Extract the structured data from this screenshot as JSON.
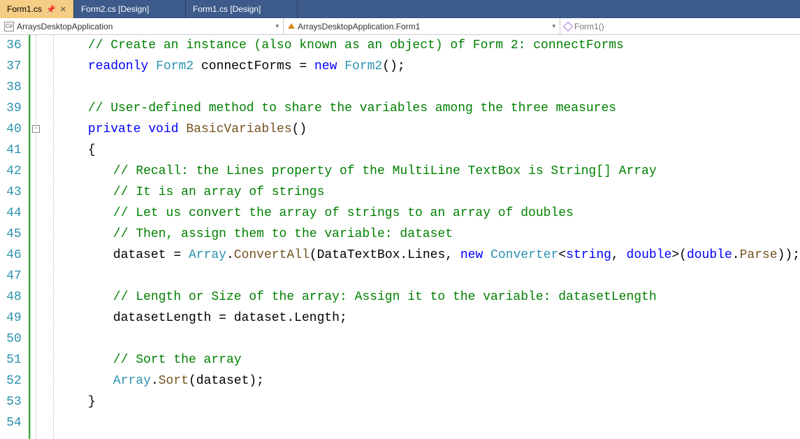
{
  "tabs": [
    {
      "label": "Form1.cs",
      "active": true,
      "pinned": true,
      "hasClose": true
    },
    {
      "label": "Form2.cs [Design]",
      "active": false
    },
    {
      "label": "Form1.cs [Design]",
      "active": false
    }
  ],
  "nav": {
    "namespace": "ArraysDesktopApplication",
    "class": "ArraysDesktopApplication.Form1",
    "member": "Form1()"
  },
  "startLine": 36,
  "code": {
    "lines": [
      {
        "i": 36,
        "ind": 2,
        "tokens": [
          {
            "c": "c-comment",
            "t": "// Create an instance (also known as an object) of Form 2: connectForms"
          }
        ]
      },
      {
        "i": 37,
        "ind": 2,
        "tokens": [
          {
            "c": "c-keyword",
            "t": "readonly"
          },
          {
            "c": "c-text",
            "t": " "
          },
          {
            "c": "c-type",
            "t": "Form2"
          },
          {
            "c": "c-text",
            "t": " connectForms = "
          },
          {
            "c": "c-keyword",
            "t": "new"
          },
          {
            "c": "c-text",
            "t": " "
          },
          {
            "c": "c-type",
            "t": "Form2"
          },
          {
            "c": "c-text",
            "t": "();"
          }
        ]
      },
      {
        "i": 38,
        "ind": 2,
        "tokens": []
      },
      {
        "i": 39,
        "ind": 2,
        "tokens": [
          {
            "c": "c-comment",
            "t": "// User-defined method to share the variables among the three measures"
          }
        ]
      },
      {
        "i": 40,
        "ind": 2,
        "tokens": [
          {
            "c": "c-keyword",
            "t": "private"
          },
          {
            "c": "c-text",
            "t": " "
          },
          {
            "c": "c-keyword",
            "t": "void"
          },
          {
            "c": "c-text",
            "t": " "
          },
          {
            "c": "c-method",
            "t": "BasicVariables"
          },
          {
            "c": "c-text",
            "t": "()"
          }
        ],
        "fold": true
      },
      {
        "i": 41,
        "ind": 2,
        "tokens": [
          {
            "c": "c-text",
            "t": "{"
          }
        ]
      },
      {
        "i": 42,
        "ind": 3,
        "tokens": [
          {
            "c": "c-comment",
            "t": "// Recall: the Lines property of the MultiLine TextBox is String[] Array"
          }
        ]
      },
      {
        "i": 43,
        "ind": 3,
        "tokens": [
          {
            "c": "c-comment",
            "t": "// It is an array of strings"
          }
        ]
      },
      {
        "i": 44,
        "ind": 3,
        "tokens": [
          {
            "c": "c-comment",
            "t": "// Let us convert the array of strings to an array of doubles"
          }
        ]
      },
      {
        "i": 45,
        "ind": 3,
        "tokens": [
          {
            "c": "c-comment",
            "t": "// Then, assign them to the variable: dataset"
          }
        ]
      },
      {
        "i": 46,
        "ind": 3,
        "tokens": [
          {
            "c": "c-text",
            "t": "dataset = "
          },
          {
            "c": "c-type",
            "t": "Array"
          },
          {
            "c": "c-text",
            "t": "."
          },
          {
            "c": "c-method",
            "t": "ConvertAll"
          },
          {
            "c": "c-text",
            "t": "(DataTextBox.Lines, "
          },
          {
            "c": "c-keyword",
            "t": "new"
          },
          {
            "c": "c-text",
            "t": " "
          },
          {
            "c": "c-type",
            "t": "Converter"
          },
          {
            "c": "c-text",
            "t": "<"
          },
          {
            "c": "c-keyword",
            "t": "string"
          },
          {
            "c": "c-text",
            "t": ", "
          },
          {
            "c": "c-keyword",
            "t": "double"
          },
          {
            "c": "c-text",
            "t": ">("
          },
          {
            "c": "c-keyword",
            "t": "double"
          },
          {
            "c": "c-text",
            "t": "."
          },
          {
            "c": "c-method",
            "t": "Parse"
          },
          {
            "c": "c-text",
            "t": "));"
          }
        ]
      },
      {
        "i": 47,
        "ind": 3,
        "tokens": []
      },
      {
        "i": 48,
        "ind": 3,
        "tokens": [
          {
            "c": "c-comment",
            "t": "// Length or Size of the array: Assign it to the variable: datasetLength"
          }
        ]
      },
      {
        "i": 49,
        "ind": 3,
        "tokens": [
          {
            "c": "c-text",
            "t": "datasetLength = dataset.Length;"
          }
        ]
      },
      {
        "i": 50,
        "ind": 3,
        "tokens": []
      },
      {
        "i": 51,
        "ind": 3,
        "tokens": [
          {
            "c": "c-comment",
            "t": "// Sort the array"
          }
        ]
      },
      {
        "i": 52,
        "ind": 3,
        "tokens": [
          {
            "c": "c-type",
            "t": "Array"
          },
          {
            "c": "c-text",
            "t": "."
          },
          {
            "c": "c-method",
            "t": "Sort"
          },
          {
            "c": "c-text",
            "t": "(dataset);"
          }
        ]
      },
      {
        "i": 53,
        "ind": 2,
        "tokens": [
          {
            "c": "c-text",
            "t": "}"
          }
        ]
      },
      {
        "i": 54,
        "ind": 2,
        "tokens": []
      }
    ]
  }
}
